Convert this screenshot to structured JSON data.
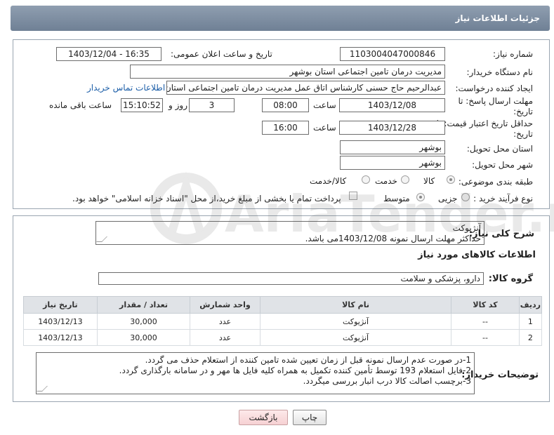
{
  "header": {
    "title": "جزئیات اطلاعات نیاز"
  },
  "form": {
    "need_number_label": "شماره نیاز:",
    "need_number": "1103004047000846",
    "announce_label": "تاریخ و ساعت اعلان عمومی:",
    "announce_value": "1403/12/04 - 16:35",
    "buyer_org_label": "نام دستگاه خریدار:",
    "buyer_org": "مدیریت درمان تامین اجتماعی استان بوشهر",
    "requester_label": "ایجاد کننده درخواست:",
    "requester": "عبدالرحیم حاج حسنی کارشناس اتاق عمل مدیریت درمان تامین اجتماعی استان بوشهر",
    "contact_link": "اطلاعات تماس خریدار",
    "reply_deadline_label": "مهلت ارسال پاسخ: تا تاریخ:",
    "reply_date": "1403/12/08",
    "time_label": "ساعت",
    "reply_time": "08:00",
    "days_count": "3",
    "days_label": "روز و",
    "remaining_time": "15:10:52",
    "remaining_label": "ساعت باقی مانده",
    "price_validity_label": "حداقل تاریخ اعتبار قیمت: تا تاریخ:",
    "price_date": "1403/12/28",
    "price_time": "16:00",
    "province_label": "استان محل تحویل:",
    "province": "بوشهر",
    "city_label": "شهر محل تحویل:",
    "city": "بوشهر",
    "category_label": "طبقه بندی موضوعی:",
    "category_options": [
      "کالا",
      "خدمت",
      "کالا/خدمت"
    ],
    "purchase_type_label": "نوع فرآیند خرید :",
    "purchase_options": [
      "جزیی",
      "متوسط"
    ],
    "treasury_note": "پرداخت تمام یا بخشی از مبلغ خرید،از محل \"اسناد خزانه اسلامی\" خواهد بود."
  },
  "summary": {
    "label": "شرح کلی نیاز:",
    "lines": [
      "آنژیوکت",
      "حداکثر مهلت ارسال نمونه 1403/12/08می باشد."
    ]
  },
  "goods_info": {
    "title": "اطلاعات کالاهای مورد نیاز",
    "group_label": "گروه کالا:",
    "group_value": "دارو، پزشکی و سلامت"
  },
  "table": {
    "headers": [
      "ردیف",
      "کد کالا",
      "نام کالا",
      "واحد شمارش",
      "تعداد / مقدار",
      "تاریخ نیاز"
    ],
    "rows": [
      [
        "1",
        "--",
        "آنژیوکت",
        "عدد",
        "30,000",
        "1403/12/13"
      ],
      [
        "2",
        "--",
        "آنژیوکت",
        "عدد",
        "30,000",
        "1403/12/13"
      ]
    ]
  },
  "notes": {
    "label": "توضیحات خریدار:",
    "lines": [
      "1-در صورت عدم ارسال نمونه قبل از زمان تعیین شده تامین کننده از استعلام حذف می گردد.",
      "2-فایل استعلام 193 توسط تأمین کننده تکمیل به همراه کلیه فایل ها مهر و در سامانه بارگذاری گردد.",
      "3-برچسب اصالت کالا درب انبار بررسی میگردد."
    ]
  },
  "buttons": {
    "print": "چاپ",
    "back": "بازگشت"
  },
  "watermark": {
    "text": "AriaTender.neT"
  }
}
